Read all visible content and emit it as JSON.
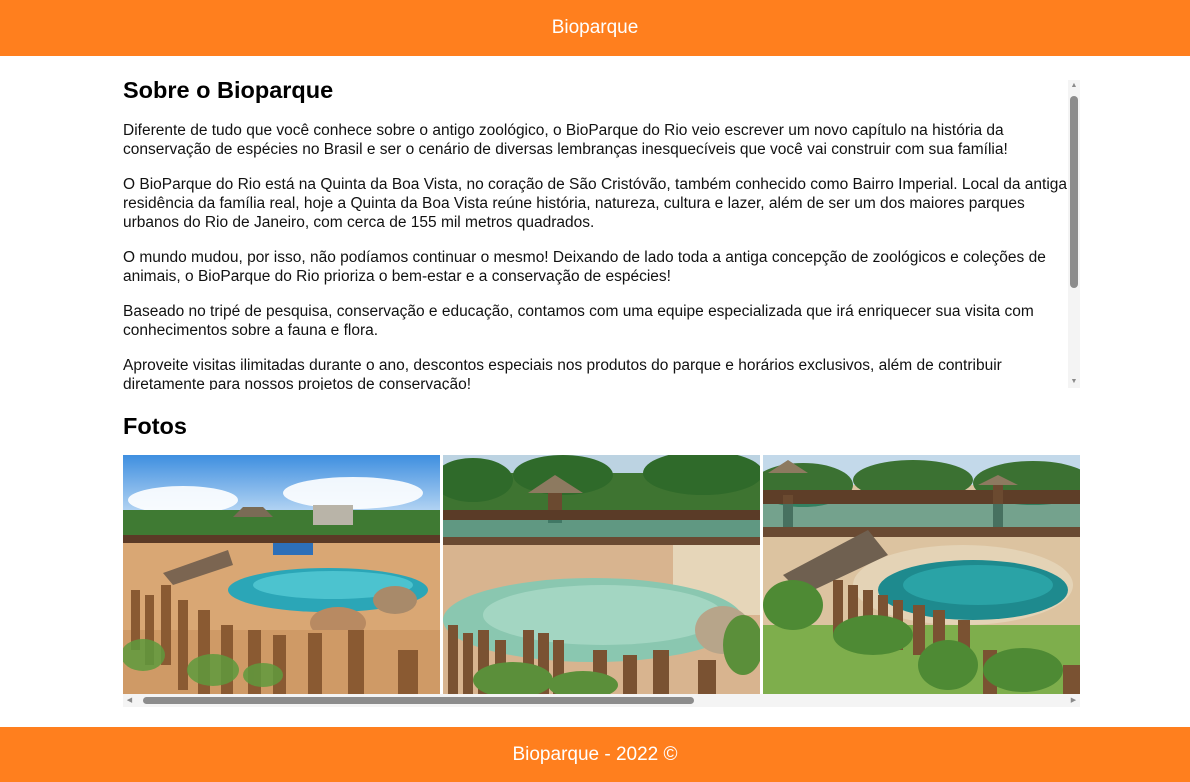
{
  "header": {
    "title": "Bioparque"
  },
  "about": {
    "heading": "Sobre o Bioparque",
    "paragraphs": [
      "Diferente de tudo que você conhece sobre o antigo zoológico, o BioParque do Rio veio escrever um novo capítulo na história da conservação de espécies no Brasil e ser o cenário de diversas lembranças inesquecíveis que você vai construir com sua família!",
      "O BioParque do Rio está na Quinta da Boa Vista, no coração de São Cristóvão, também conhecido como Bairro Imperial. Local da antiga residência da família real, hoje a Quinta da Boa Vista reúne história, natureza, cultura e lazer, além de ser um dos maiores parques urbanos do Rio de Janeiro, com cerca de 155 mil metros quadrados.",
      "O mundo mudou, por isso, não podíamos continuar o mesmo! Deixando de lado toda a antiga concepção de zoológicos e coleções de animais, o BioParque do Rio prioriza o bem-estar e a conservação de espécies!",
      "Baseado no tripé de pesquisa, conservação e educação, contamos com uma equipe especializada que irá enriquecer sua visita com conhecimentos sobre a fauna e flora.",
      "Aproveite visitas ilimitadas durante o ano, descontos especiais nos produtos do parque e horários exclusivos, além de contribuir diretamente para nossos projetos de conservação!"
    ]
  },
  "photos": {
    "heading": "Fotos",
    "items": [
      {
        "icon": "photo-pond-with-wooden-posts"
      },
      {
        "icon": "photo-pool-with-thatched-hut"
      },
      {
        "icon": "photo-lagoon-with-boardwalk"
      }
    ]
  },
  "footer": {
    "text": "Bioparque - 2022 ©"
  },
  "colors": {
    "brand": "#ff7f1e",
    "scroll_thumb": "#8c8c8c",
    "scroll_track": "#f4f4f4"
  }
}
